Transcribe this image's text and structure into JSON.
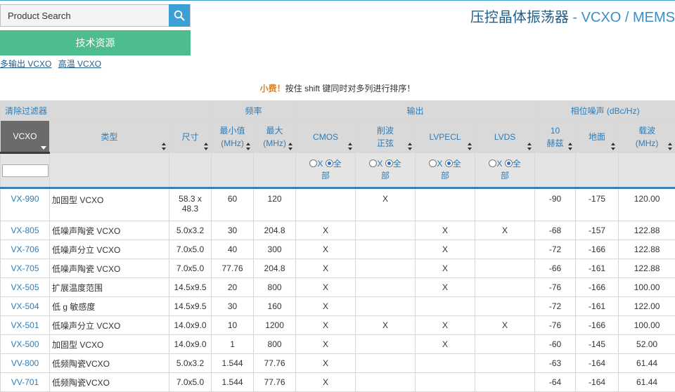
{
  "search": {
    "placeholder": "Product Search"
  },
  "tech_button": "技术资源",
  "links": [
    "多输出 VCXO",
    "高温 VCXO"
  ],
  "title": {
    "zh": "压控晶体振荡器",
    "sep": " - ",
    "en": "VCXO / MEMS"
  },
  "hint": {
    "tip": "小费！",
    "text": "按住 shift 键同时对多列进行排序！"
  },
  "groups": {
    "clear": "清除过滤器",
    "frequency": "频率",
    "output": "输出",
    "phase_noise": "相位噪声 (dBc/Hz)"
  },
  "columns": {
    "vcxo": "VCXO",
    "type": "类型",
    "size": "尺寸",
    "min_line1": "最小值",
    "min_line2": "(MHz)",
    "max_line1": "最大",
    "max_line2": "(MHz)",
    "cmos": "CMOS",
    "clip_line1": "削波",
    "clip_line2": "正弦",
    "lvpecl": "LVPECL",
    "lvds": "LVDS",
    "pn10_line1": "10",
    "pn10_line2": "赫兹",
    "floor": "地面",
    "carrier_line1": "载波",
    "carrier_line2": "(MHz)"
  },
  "filter": {
    "x_label": "X",
    "all_label_1": "全",
    "all_label_2": "部"
  },
  "rows": [
    {
      "part": "VX-990",
      "type": "加固型 VCXO",
      "size_1": "58.3 x",
      "size_2": "48.3",
      "min": "60",
      "max": "120",
      "cmos": "",
      "clip": "X",
      "lvpecl": "",
      "lvds": "",
      "pn10": "-90",
      "floor": "-175",
      "carrier": "120.00"
    },
    {
      "part": "VX-805",
      "type": "低噪声陶瓷 VCXO",
      "size_1": "5.0x3.2",
      "size_2": "",
      "min": "30",
      "max": "204.8",
      "cmos": "X",
      "clip": "",
      "lvpecl": "X",
      "lvds": "X",
      "pn10": "-68",
      "floor": "-157",
      "carrier": "122.88"
    },
    {
      "part": "VX-706",
      "type": "低噪声分立 VCXO",
      "size_1": "7.0x5.0",
      "size_2": "",
      "min": "40",
      "max": "300",
      "cmos": "X",
      "clip": "",
      "lvpecl": "X",
      "lvds": "",
      "pn10": "-72",
      "floor": "-166",
      "carrier": "122.88"
    },
    {
      "part": "VX-705",
      "type": "低噪声陶瓷 VCXO",
      "size_1": "7.0x5.0",
      "size_2": "",
      "min": "77.76",
      "max": "204.8",
      "cmos": "X",
      "clip": "",
      "lvpecl": "X",
      "lvds": "",
      "pn10": "-66",
      "floor": "-161",
      "carrier": "122.88"
    },
    {
      "part": "VX-505",
      "type": "扩展温度范围",
      "size_1": "14.5x9.5",
      "size_2": "",
      "min": "20",
      "max": "800",
      "cmos": "X",
      "clip": "",
      "lvpecl": "X",
      "lvds": "",
      "pn10": "-76",
      "floor": "-166",
      "carrier": "100.00"
    },
    {
      "part": "VX-504",
      "type": "低 g 敏感度",
      "size_1": "14.5x9.5",
      "size_2": "",
      "min": "30",
      "max": "160",
      "cmos": "X",
      "clip": "",
      "lvpecl": "",
      "lvds": "",
      "pn10": "-72",
      "floor": "-161",
      "carrier": "122.00"
    },
    {
      "part": "VX-501",
      "type": "低噪声分立 VCXO",
      "size_1": "14.0x9.0",
      "size_2": "",
      "min": "10",
      "max": "1200",
      "cmos": "X",
      "clip": "X",
      "lvpecl": "X",
      "lvds": "X",
      "pn10": "-76",
      "floor": "-166",
      "carrier": "100.00"
    },
    {
      "part": "VX-500",
      "type": "加固型 VCXO",
      "size_1": "14.0x9.0",
      "size_2": "",
      "min": "1",
      "max": "800",
      "cmos": "X",
      "clip": "",
      "lvpecl": "X",
      "lvds": "",
      "pn10": "-60",
      "floor": "-145",
      "carrier": "52.00"
    },
    {
      "part": "VV-800",
      "type": "低频陶瓷VCXO",
      "size_1": "5.0x3.2",
      "size_2": "",
      "min": "1.544",
      "max": "77.76",
      "cmos": "X",
      "clip": "",
      "lvpecl": "",
      "lvds": "",
      "pn10": "-63",
      "floor": "-164",
      "carrier": "61.44"
    },
    {
      "part": "VV-701",
      "type": "低频陶瓷VCXO",
      "size_1": "7.0x5.0",
      "size_2": "",
      "min": "1.544",
      "max": "77.76",
      "cmos": "X",
      "clip": "",
      "lvpecl": "",
      "lvds": "",
      "pn10": "-64",
      "floor": "-164",
      "carrier": "61.44"
    }
  ]
}
